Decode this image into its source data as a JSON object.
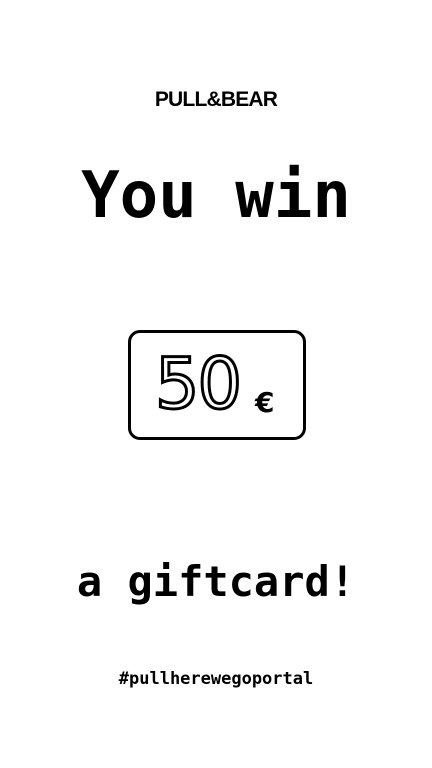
{
  "brand": {
    "logo_text": "PULL&BEAR"
  },
  "prize": {
    "headline": "You win",
    "amount": "50",
    "currency": "€",
    "subline": "a giftcard!"
  },
  "footer": {
    "hashtag": "#pullherewegoportal"
  },
  "colors": {
    "background": "#ffffff",
    "text": "#000000"
  }
}
